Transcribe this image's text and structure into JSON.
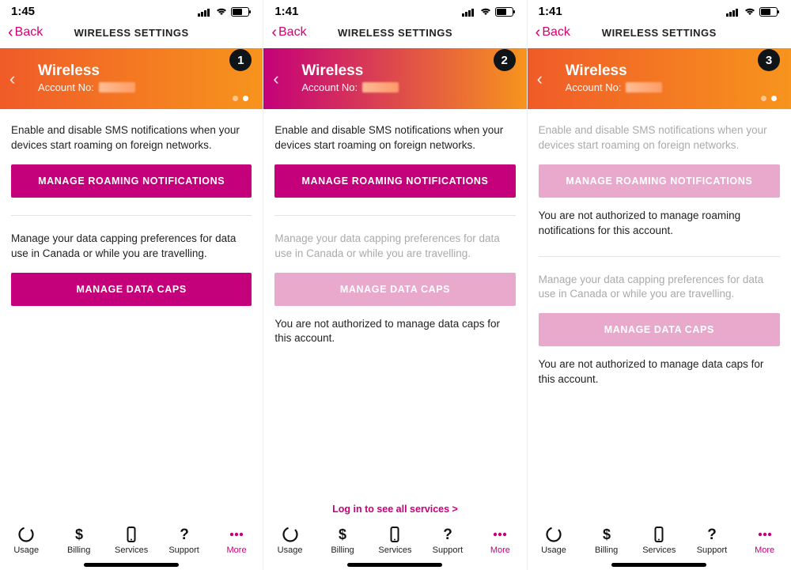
{
  "screens": [
    {
      "status_time": "1:45",
      "badge": "1",
      "back_label": "Back",
      "nav_title": "WIRELESS SETTINGS",
      "hero_title": "Wireless",
      "account_label": "Account No:",
      "roaming_desc": "Enable and disable SMS notifications when your devices start roaming on foreign networks.",
      "roaming_btn": "MANAGE ROAMING NOTIFICATIONS",
      "roaming_disabled": false,
      "roaming_noauth": "",
      "caps_desc": "Manage your data capping preferences for data use in Canada or while you are travelling.",
      "caps_btn": "MANAGE DATA CAPS",
      "caps_disabled": false,
      "caps_noauth": "",
      "login_link": "",
      "dots": true
    },
    {
      "status_time": "1:41",
      "badge": "2",
      "back_label": "Back",
      "nav_title": "WIRELESS SETTINGS",
      "hero_title": "Wireless",
      "account_label": "Account No:",
      "roaming_desc": "Enable and disable SMS notifications when your devices start roaming on foreign networks.",
      "roaming_btn": "MANAGE ROAMING NOTIFICATIONS",
      "roaming_disabled": false,
      "roaming_noauth": "",
      "caps_desc": "Manage your data capping preferences for data use in Canada or while you are travelling.",
      "caps_btn": "MANAGE DATA CAPS",
      "caps_disabled": true,
      "caps_noauth": "You are not authorized to manage data caps for this account.",
      "login_link": "Log in to see all services >",
      "dots": false
    },
    {
      "status_time": "1:41",
      "badge": "3",
      "back_label": "Back",
      "nav_title": "WIRELESS SETTINGS",
      "hero_title": "Wireless",
      "account_label": "Account No:",
      "roaming_desc": "Enable and disable SMS notifications when your devices start roaming on foreign networks.",
      "roaming_btn": "MANAGE ROAMING NOTIFICATIONS",
      "roaming_disabled": true,
      "roaming_noauth": "You are not authorized to manage roaming notifications for this account.",
      "caps_desc": "Manage your data capping preferences for data use in Canada or while you are travelling.",
      "caps_btn": "MANAGE DATA CAPS",
      "caps_disabled": true,
      "caps_noauth": "You are not authorized to manage data caps for this account.",
      "login_link": "",
      "dots": true
    }
  ],
  "tabs": [
    {
      "label": "Usage",
      "icon": "usage"
    },
    {
      "label": "Billing",
      "icon": "dollar"
    },
    {
      "label": "Services",
      "icon": "phone"
    },
    {
      "label": "Support",
      "icon": "question"
    },
    {
      "label": "More",
      "icon": "more",
      "active": true
    }
  ]
}
